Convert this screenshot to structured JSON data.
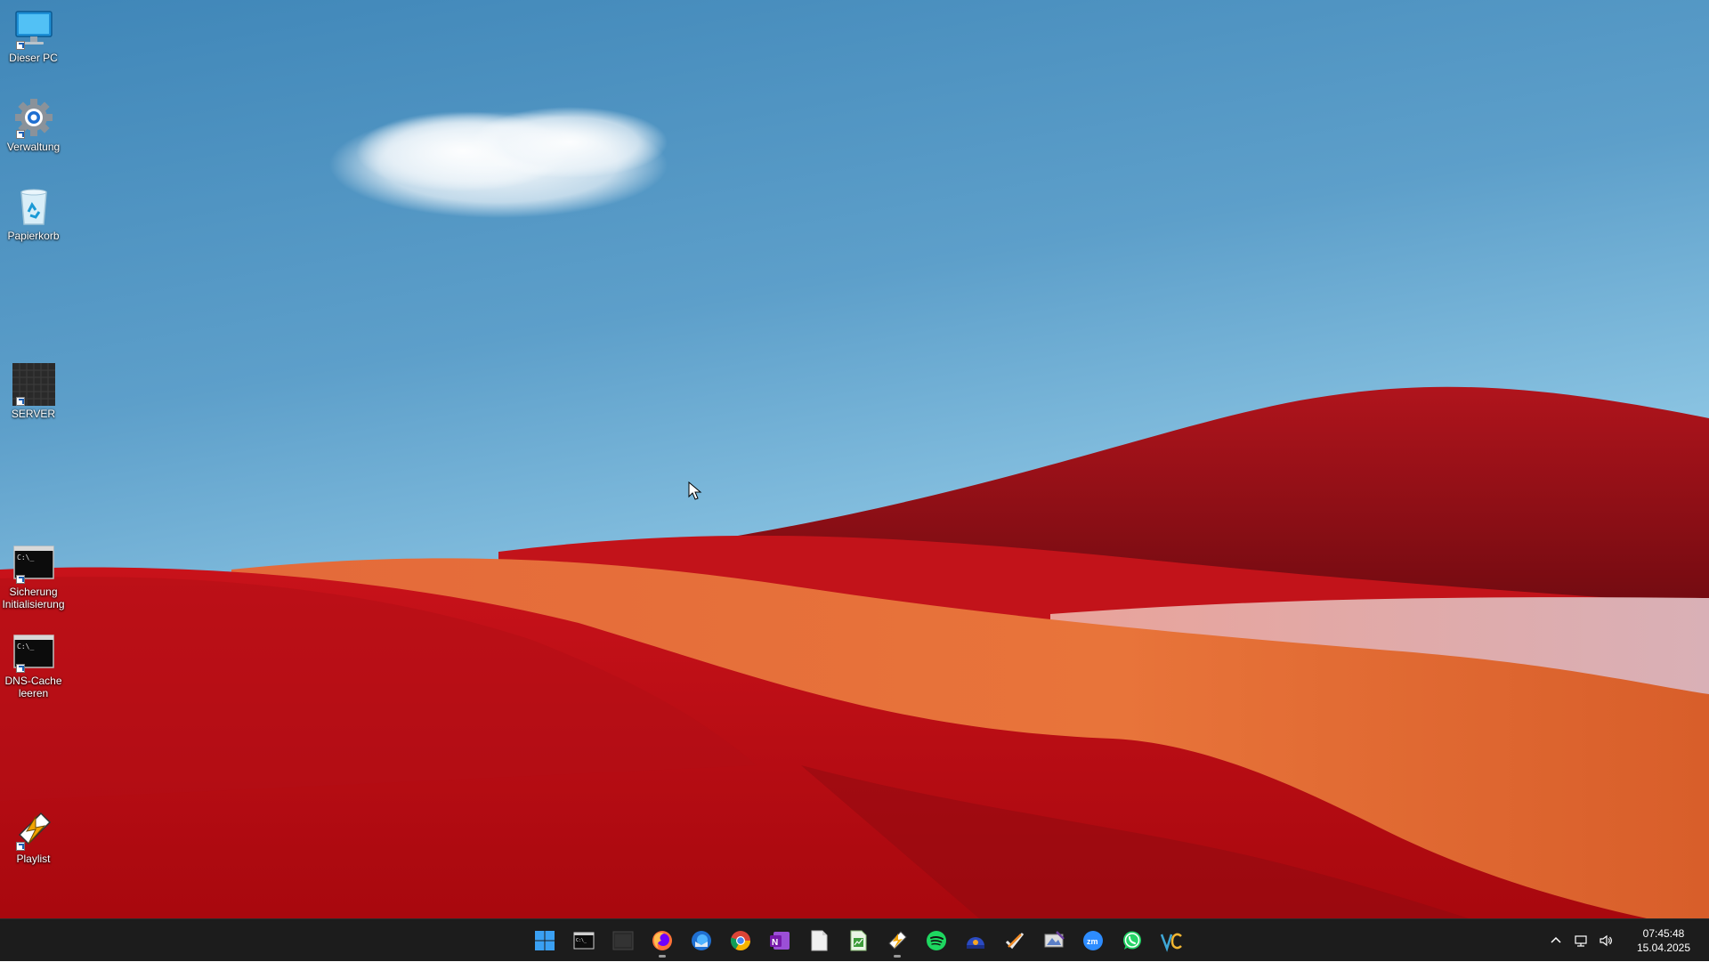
{
  "desktop": {
    "icons": [
      {
        "label": "Dieser PC",
        "icon": "monitor-icon"
      },
      {
        "label": "Verwaltung",
        "icon": "gear-icon"
      },
      {
        "label": "Papierkorb",
        "icon": "recycle-bin-icon"
      },
      {
        "label": "SERVER",
        "icon": "server-icon"
      },
      {
        "label": "Sicherung\nInitialisierung",
        "icon": "terminal-icon"
      },
      {
        "label": "DNS-Cache\nleeren",
        "icon": "terminal-icon"
      },
      {
        "label": "Playlist",
        "icon": "playlist-icon"
      }
    ]
  },
  "taskbar": {
    "apps": [
      {
        "name": "start",
        "icon": "windows-start-icon"
      },
      {
        "name": "terminal",
        "icon": "terminal-icon"
      },
      {
        "name": "black-window",
        "icon": "dark-window-icon"
      },
      {
        "name": "firefox",
        "icon": "firefox-icon",
        "running": true
      },
      {
        "name": "thunderbird",
        "icon": "mail-client-icon"
      },
      {
        "name": "chrome",
        "icon": "chrome-icon"
      },
      {
        "name": "onenote",
        "icon": "onenote-icon"
      },
      {
        "name": "document",
        "icon": "document-icon"
      },
      {
        "name": "spreadsheet",
        "icon": "spreadsheet-icon"
      },
      {
        "name": "playlist",
        "icon": "playlist-icon",
        "running": true
      },
      {
        "name": "spotify",
        "icon": "spotify-icon"
      },
      {
        "name": "bluetooth-app",
        "icon": "blue-dome-icon"
      },
      {
        "name": "todo",
        "icon": "check-tools-icon"
      },
      {
        "name": "image-editor",
        "icon": "paint-icon"
      },
      {
        "name": "zoom",
        "icon": "zoom-icon"
      },
      {
        "name": "whatsapp",
        "icon": "whatsapp-icon"
      },
      {
        "name": "veracrypt",
        "icon": "vc-icon"
      }
    ],
    "tray": {
      "chevron_icon": "chevron-up-icon",
      "network_icon": "network-icon",
      "volume_icon": "volume-icon",
      "time": "07:45:48",
      "date": "15.04.2025"
    }
  }
}
